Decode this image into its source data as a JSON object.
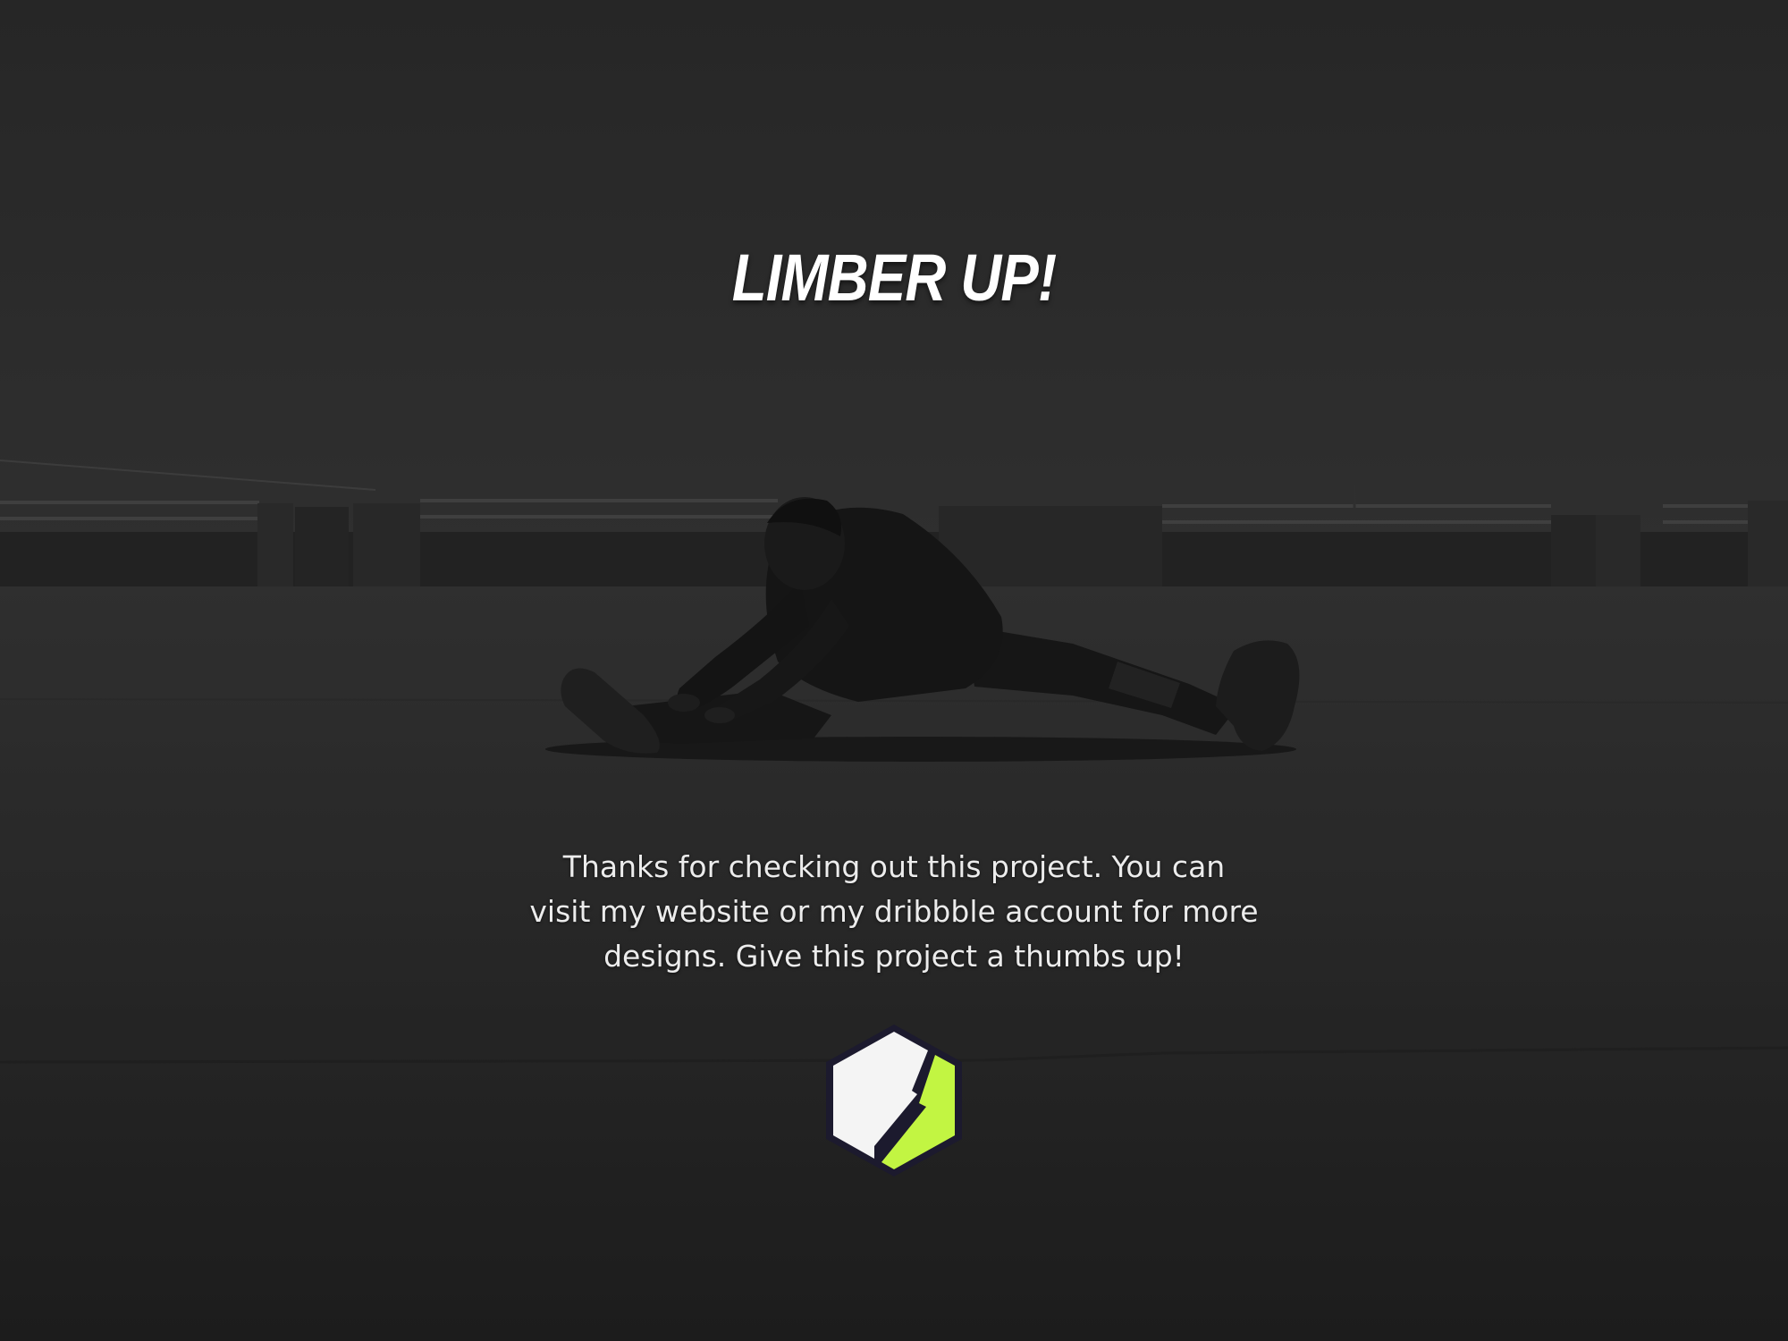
{
  "headline": "LIMBER UP!",
  "message_lines": [
    "Thanks for checking out this project. You can",
    "visit my website or my dribbble account for more",
    "designs. Give this project a thumbs up!"
  ],
  "logo": {
    "icon": "lightning-hexagon-logo",
    "colors": {
      "left_half": "#f4f4f4",
      "right_half": "#c2f542",
      "outline": "#1c1a2e"
    }
  },
  "background": {
    "description_icon": "rooftop-stretch-photo",
    "overlay_color": "#2b2b2b"
  }
}
